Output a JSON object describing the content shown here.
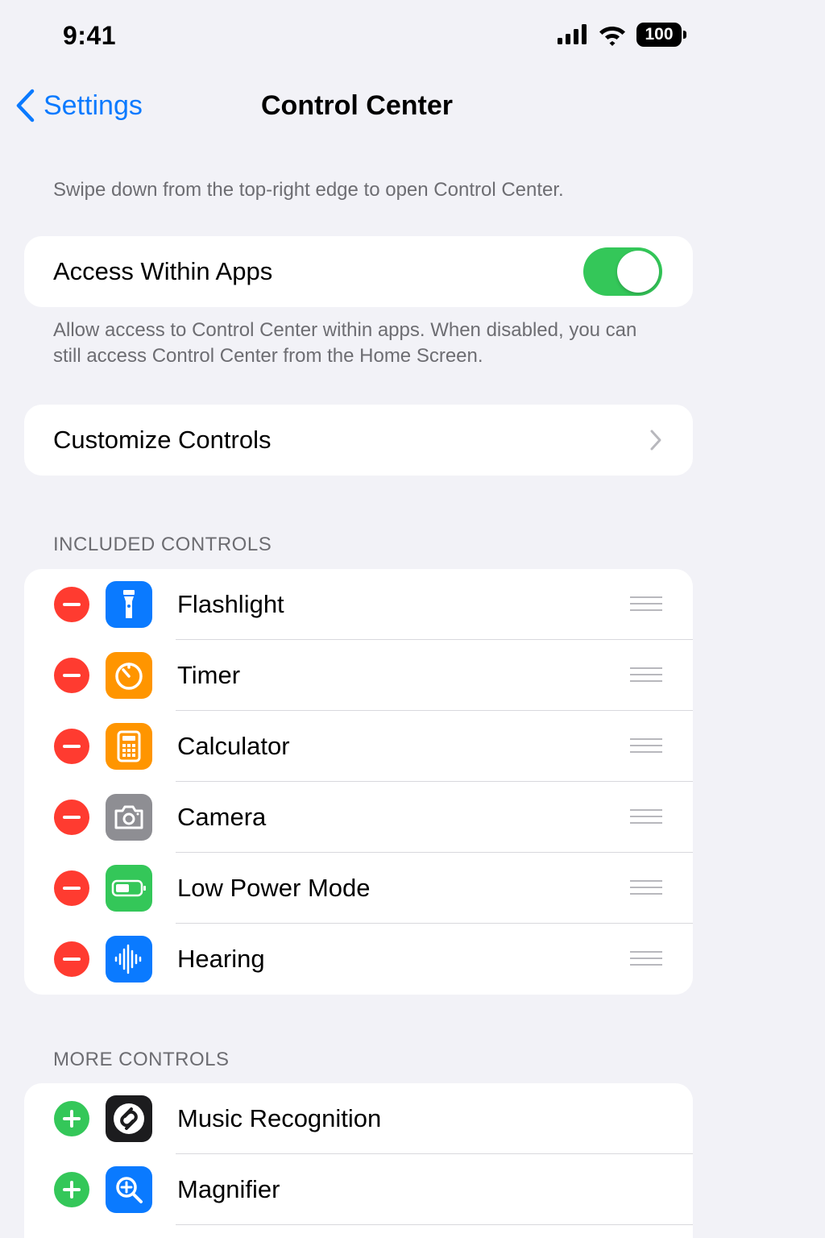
{
  "status_bar": {
    "time": "9:41",
    "battery": "100",
    "icons": [
      "signal-icon",
      "wifi-icon",
      "battery-icon"
    ]
  },
  "nav": {
    "back_label": "Settings",
    "title": "Control Center"
  },
  "intro_text": "Swipe down from the top-right edge to open Control Center.",
  "access_within_apps": {
    "label": "Access Within Apps",
    "enabled": true,
    "footer": "Allow access to Control Center within apps. When disabled, you can still access Control Center from the Home Screen."
  },
  "customize": {
    "label": "Customize Controls"
  },
  "included_controls": {
    "header": "INCLUDED CONTROLS",
    "items": [
      {
        "label": "Flashlight",
        "icon": "flashlight-icon",
        "color": "#0a7aff"
      },
      {
        "label": "Timer",
        "icon": "timer-icon",
        "color": "#ff9500"
      },
      {
        "label": "Calculator",
        "icon": "calculator-icon",
        "color": "#ff9500"
      },
      {
        "label": "Camera",
        "icon": "camera-icon",
        "color": "#8e8e93"
      },
      {
        "label": "Low Power Mode",
        "icon": "battery-icon",
        "color": "#34c759"
      },
      {
        "label": "Hearing",
        "icon": "hearing-icon",
        "color": "#0a7aff"
      }
    ]
  },
  "more_controls": {
    "header": "MORE CONTROLS",
    "items": [
      {
        "label": "Music Recognition",
        "icon": "shazam-icon",
        "color": "#1c1c1e"
      },
      {
        "label": "Magnifier",
        "icon": "magnifier-icon",
        "color": "#0a7aff"
      }
    ]
  },
  "colors": {
    "background": "#f2f2f7",
    "accent": "#0a7aff",
    "toggle_on": "#34c759",
    "remove": "#ff3b30",
    "add": "#34c759",
    "secondary_text": "#6d6d72"
  }
}
